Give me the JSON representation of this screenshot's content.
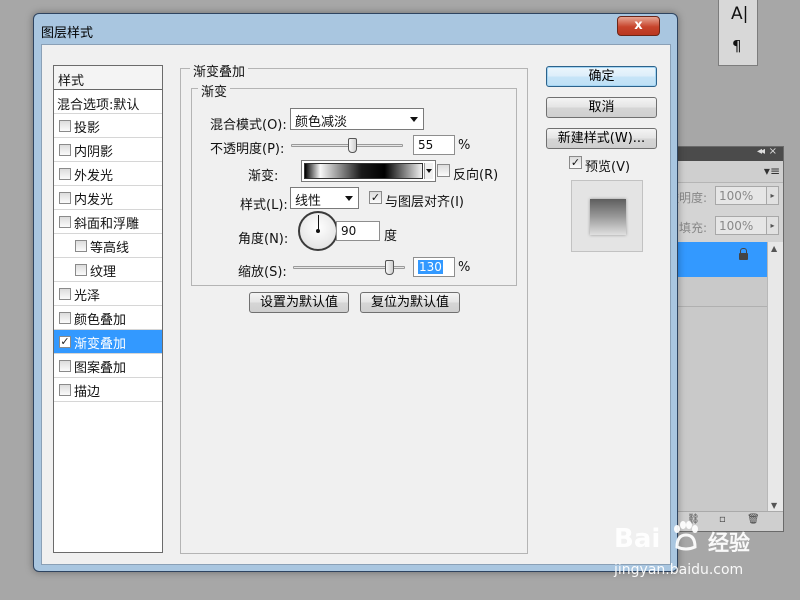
{
  "dialog": {
    "title": "图层样式",
    "close_symbol": "x"
  },
  "style_list": {
    "header": "样式",
    "blend_options": "混合选项:默认",
    "items": [
      {
        "label": "投影",
        "checked": false
      },
      {
        "label": "内阴影",
        "checked": false
      },
      {
        "label": "外发光",
        "checked": false
      },
      {
        "label": "内发光",
        "checked": false
      },
      {
        "label": "斜面和浮雕",
        "checked": false
      },
      {
        "label": "等高线",
        "checked": false
      },
      {
        "label": "纹理",
        "checked": false
      },
      {
        "label": "光泽",
        "checked": false
      },
      {
        "label": "颜色叠加",
        "checked": false
      },
      {
        "label": "渐变叠加",
        "checked": true,
        "selected": true
      },
      {
        "label": "图案叠加",
        "checked": false
      },
      {
        "label": "描边",
        "checked": false
      }
    ]
  },
  "gradient_overlay": {
    "group_title": "渐变叠加",
    "sub_group_title": "渐变",
    "blend_mode_label": "混合模式(O):",
    "blend_mode_value": "颜色减淡",
    "opacity_label": "不透明度(P):",
    "opacity_value": "55",
    "opacity_fraction": 0.55,
    "percent_sign": "%",
    "gradient_label": "渐变:",
    "reverse_label": "反向(R)",
    "reverse_checked": false,
    "style_label": "样式(L):",
    "style_value": "线性",
    "align_label": "与图层对齐(I)",
    "align_checked": true,
    "angle_label": "角度(N):",
    "angle_value": "90",
    "angle_unit": "度",
    "scale_label": "缩放(S):",
    "scale_value": "130",
    "scale_fraction": 0.87,
    "set_default_button": "设置为默认值",
    "reset_default_button": "复位为默认值"
  },
  "buttons": {
    "ok": "确定",
    "cancel": "取消",
    "new_style": "新建样式(W)...",
    "preview_label": "预览(V)",
    "preview_checked": true
  },
  "char_panel": {
    "glyph_a": "A|",
    "glyph_pilcrow": "¶"
  },
  "layers_panel": {
    "opacity_label": "透明度:",
    "opacity_value": "100%",
    "fill_label": "填充:",
    "fill_value": "100%",
    "selection_color": "#3399ff"
  },
  "watermark": {
    "logo": "Bai",
    "logo_suffix": "经验",
    "url": "jingyan.baidu.com"
  },
  "colors": {
    "accent": "#3399ff",
    "title_bar": "#a9c6e0",
    "close_button": "#c7442c"
  }
}
